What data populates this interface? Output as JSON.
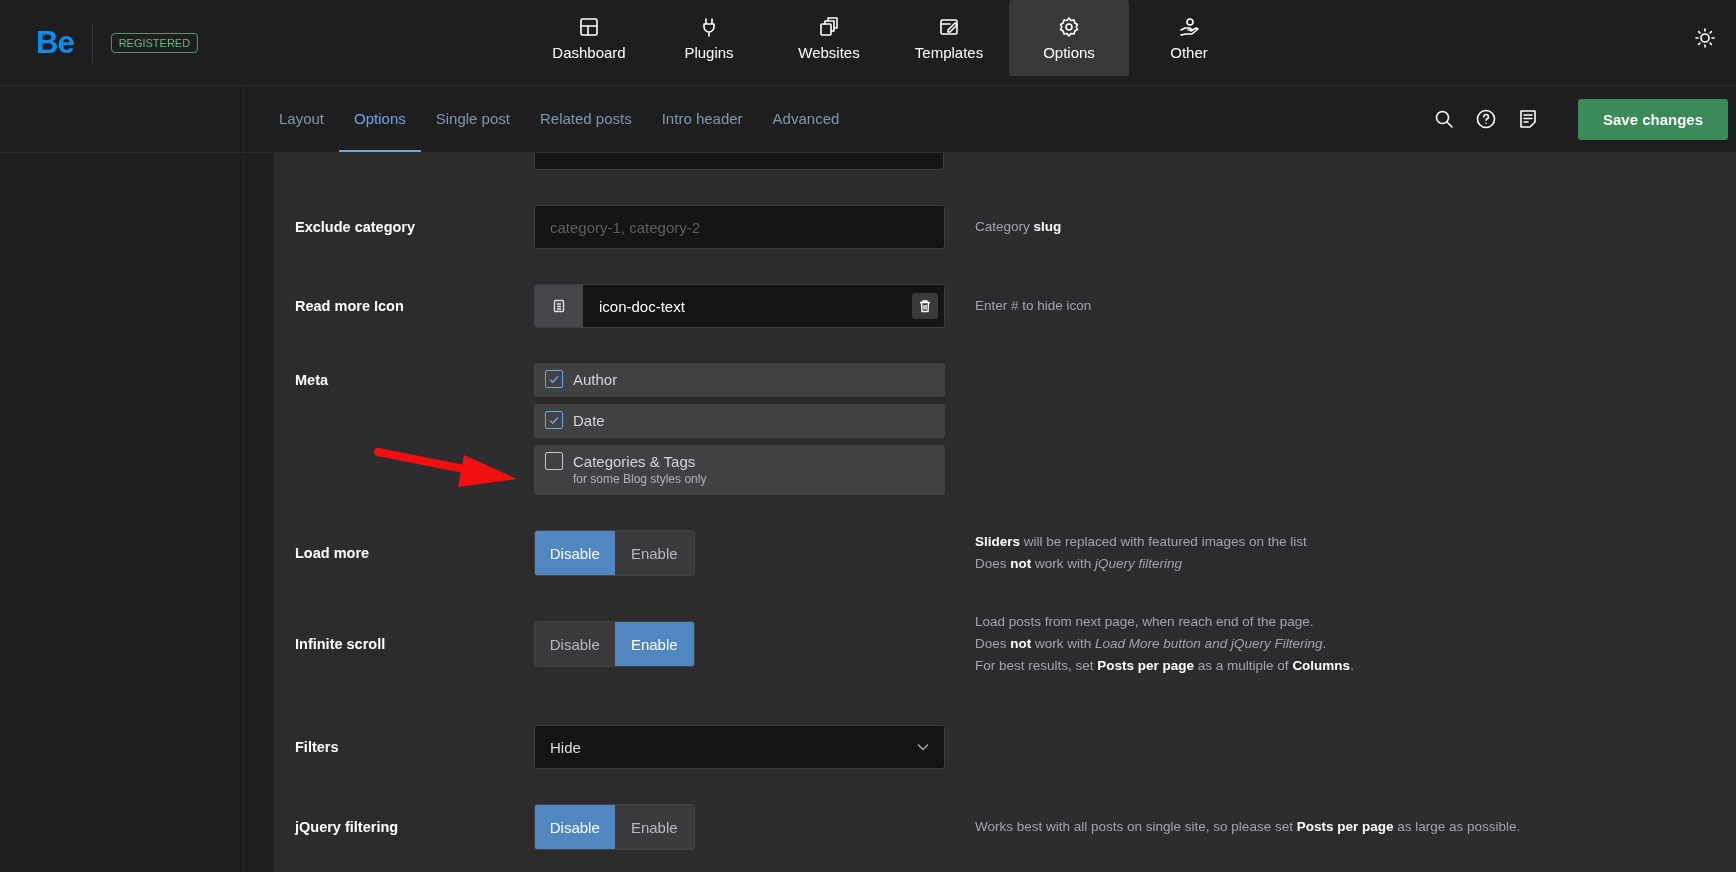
{
  "header": {
    "logo": "Be",
    "badge": "REGISTERED"
  },
  "nav": [
    {
      "label": "Dashboard",
      "selected": false
    },
    {
      "label": "Plugins",
      "selected": false
    },
    {
      "label": "Websites",
      "selected": false
    },
    {
      "label": "Templates",
      "selected": false
    },
    {
      "label": "Options",
      "selected": true
    },
    {
      "label": "Other",
      "selected": false
    }
  ],
  "subnav": {
    "tabs": [
      {
        "label": "Layout",
        "selected": false
      },
      {
        "label": "Options",
        "selected": true
      },
      {
        "label": "Single post",
        "selected": false
      },
      {
        "label": "Related posts",
        "selected": false
      },
      {
        "label": "Intro header",
        "selected": false
      },
      {
        "label": "Advanced",
        "selected": false
      }
    ],
    "save_button": "Save changes"
  },
  "rows": [
    {
      "kind": "cutfield"
    },
    {
      "kind": "text",
      "label": "Exclude category",
      "placeholder": "category-1, category-2",
      "help": [
        "Category **slug**"
      ]
    },
    {
      "kind": "icon",
      "label": "Read more Icon",
      "value": "icon-doc-text",
      "help": [
        "Enter # to hide icon"
      ]
    },
    {
      "kind": "checks",
      "label": "Meta",
      "options": [
        {
          "label": "Author",
          "checked": true
        },
        {
          "label": "Date",
          "checked": true
        },
        {
          "label": "Categories & Tags",
          "note": "for some Blog styles only",
          "checked": false
        }
      ]
    },
    {
      "kind": "toggle",
      "label": "Load more",
      "options": [
        {
          "label": "Disable",
          "selected": true
        },
        {
          "label": "Enable",
          "selected": false
        }
      ],
      "help": [
        "**Sliders** will be replaced with featured images on the list",
        "Does **not** work with *jQuery filtering*"
      ]
    },
    {
      "kind": "toggle",
      "label": "Infinite scroll",
      "options": [
        {
          "label": "Disable",
          "selected": false
        },
        {
          "label": "Enable",
          "selected": true
        }
      ],
      "help": [
        "Load posts from next page, when reach end of the page.",
        "Does **not** work with *Load More button and jQuery Filtering*.",
        "For best results, set **Posts per page** as a multiple of **Columns**."
      ]
    },
    {
      "kind": "select",
      "label": "Filters",
      "value": "Hide"
    },
    {
      "kind": "toggle",
      "label": "jQuery filtering",
      "options": [
        {
          "label": "Disable",
          "selected": true
        },
        {
          "label": "Enable",
          "selected": false
        }
      ],
      "help": [
        "Works best with all posts on single site, so please set **Posts per page** as large as possible."
      ]
    }
  ]
}
